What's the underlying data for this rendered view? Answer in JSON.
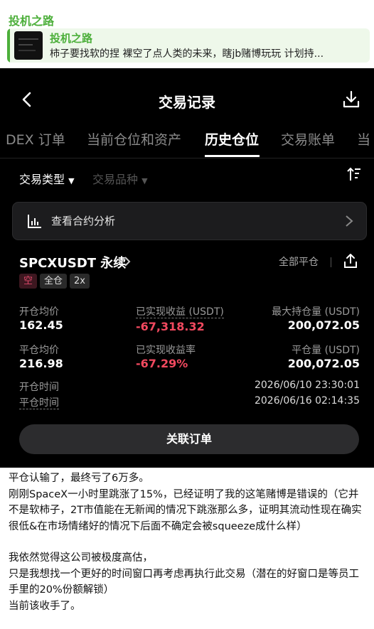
{
  "channel": {
    "name": "投机之路",
    "reply": {
      "title": "投机之路",
      "text": "柿子要找软的捏 裸空了点人类的未来，瞎jb赌博玩玩 计划持..."
    }
  },
  "app": {
    "title": "交易记录",
    "tabs": [
      "DEX 订单",
      "当前仓位和资产",
      "历史仓位",
      "交易账单",
      "当"
    ],
    "active_tab": "历史仓位",
    "filters": {
      "type": "交易类型",
      "instrument": "交易品种"
    },
    "analysis_label": "查看合约分析",
    "position": {
      "pair": "SPCXUSDT 永续",
      "close_all": "全部平仓",
      "tags": [
        "空",
        "全仓",
        "2x"
      ],
      "open_avg_label": "开仓均价",
      "open_avg": "162.45",
      "realized_pnl_label": "已实现收益 (USDT)",
      "realized_pnl": "-67,318.32",
      "max_pos_label": "最大持仓量 (USDT)",
      "max_pos": "200,072.05",
      "close_avg_label": "平仓均价",
      "close_avg": "216.98",
      "pnl_rate_label": "已实现收益率",
      "pnl_rate": "-67.29%",
      "closed_amt_label": "平仓量 (USDT)",
      "closed_amt": "200,072.05",
      "open_time_label": "开仓时间",
      "open_time": "2026/06/10 23:30:01",
      "close_time_label": "平仓时间",
      "close_time": "2026/06/16 02:14:35"
    },
    "linked_orders": "关联订单"
  },
  "post": {
    "lines": [
      "平仓认输了，最终亏了6万多。",
      "刚刚SpaceX一小时里跳涨了15%，已经证明了我的这笔赌博是错误的（它并不是软柿子，2T市值能在无新闻的情况下跳涨那么多，证明其流动性现在确实很低&在市场情绪好的情况下后面不确定会被squeeze成什么样）",
      "",
      "我依然觉得这公司被极度高估，",
      "只是我想找一个更好的时间窗口再考虑再执行此交易（潜在的好窗口是等员工手里的20%份额解锁）",
      "当前该收手了。"
    ]
  },
  "colors": {
    "brand_green": "#4caf3a",
    "loss_red": "#f2495f",
    "app_bg": "#000000"
  }
}
